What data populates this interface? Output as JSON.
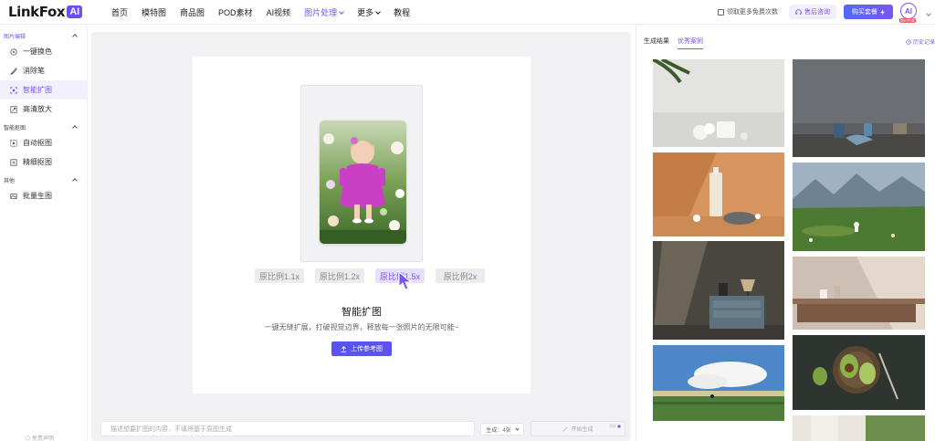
{
  "topbar": {
    "logo_text": "LinkFox",
    "logo_badge": "AI",
    "nav": [
      "首页",
      "模特图",
      "商品图",
      "POD素材",
      "AI视频",
      "图片处理",
      "更多",
      "教程"
    ],
    "free_link": "领取更多免费次数",
    "support_label": "售后咨询",
    "plan_label": "购买套餐",
    "avatar_text": "AI",
    "avatar_badge": "限时特惠"
  },
  "sidebar": {
    "sections": [
      {
        "title": "图片编辑",
        "items": [
          "一键换色",
          "消除笔",
          "智能扩图",
          "高清放大"
        ]
      },
      {
        "title": "智能抠图",
        "items": [
          "自动抠图",
          "精细抠图"
        ]
      },
      {
        "title": "其他",
        "items": [
          "批量生图"
        ]
      }
    ],
    "footer": "免责声明"
  },
  "main": {
    "ratios": [
      "原比例1.1x",
      "原比例1.2x",
      "原比例1.5x",
      "原比例2x"
    ],
    "selected_ratio_index": 2,
    "title": "智能扩图",
    "subtitle": "一键无缝扩展，打破视觉边界，释放每一张照片的无限可能~",
    "upload_label": "上传参考图",
    "prompt_placeholder": "描述想要扩图的内容，不填将基于原图生成",
    "gen_count_label": "生成：4张",
    "gen_button_label": "开始生成",
    "gen_cost": "消耗"
  },
  "right": {
    "tabs": [
      "生成结果",
      "优秀案例"
    ],
    "active_tab": 1,
    "history_label": "历史记录"
  },
  "colors": {
    "accent": "#7a55f5",
    "brand_blue": "#5b52f2"
  }
}
